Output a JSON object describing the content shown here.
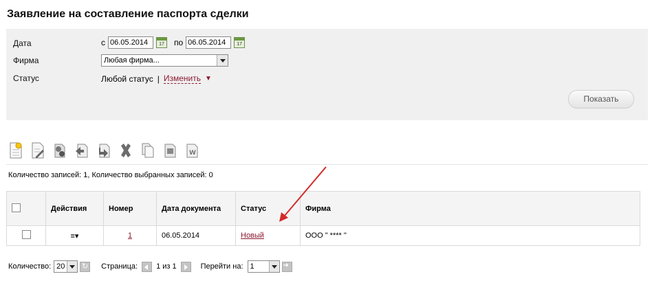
{
  "page": {
    "title": "Заявление на составление паспорта сделки"
  },
  "filter": {
    "date_label": "Дата",
    "date_from_prefix": "с",
    "date_from": "06.05.2014",
    "date_to_prefix": "по",
    "date_to": "06.05.2014",
    "calendar_icon_text": "17",
    "firm_label": "Фирма",
    "firm_value": "Любая фирма...",
    "status_label": "Статус",
    "status_value": "Любой статус",
    "status_sep": "|",
    "change_label": "Изменить",
    "show_button": "Показать"
  },
  "toolbar": {
    "icons": [
      "new-document-icon",
      "edit-document-icon",
      "sign-document-icon",
      "send-document-icon",
      "receive-document-icon",
      "delete-icon",
      "copy-icon",
      "print-icon",
      "export-word-icon"
    ]
  },
  "counts": {
    "text": "Количество записей: 1, Количество выбранных записей: 0"
  },
  "table": {
    "headers": {
      "actions": "Действия",
      "number": "Номер",
      "date": "Дата документа",
      "status": "Статус",
      "firm": "Фирма"
    },
    "rows": [
      {
        "actions_icon": "≡▾",
        "number": "1",
        "date": "06.05.2014",
        "status": "Новый",
        "firm": "ООО \" **** \""
      }
    ]
  },
  "footer": {
    "qty_label": "Количество:",
    "qty_value": "20",
    "page_label": "Страница:",
    "page_info": "1 из 1",
    "goto_label": "Перейти на:",
    "goto_value": "1"
  },
  "colors": {
    "accent_link": "#8b1a2f",
    "annotation_arrow": "#d42a2a",
    "filter_bg": "#f0f0f0"
  }
}
